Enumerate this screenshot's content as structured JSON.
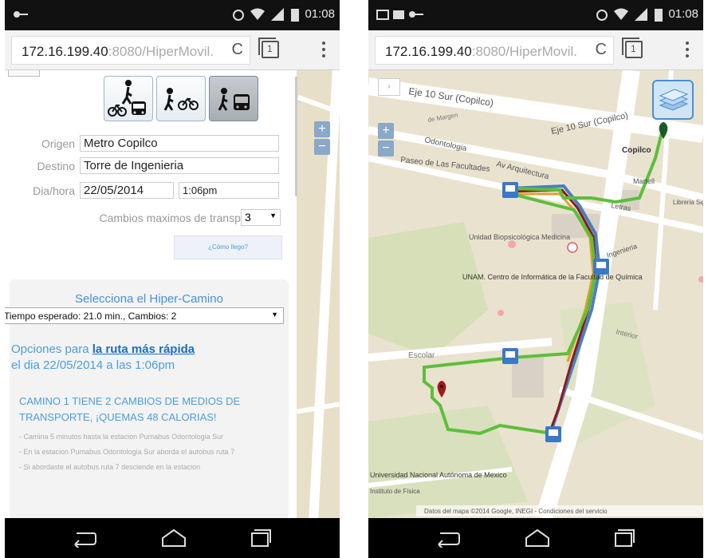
{
  "status": {
    "time": "01:08"
  },
  "left": {
    "url": {
      "host": "172.16.199.40",
      "path": ":8080/HiperMovil."
    },
    "form": {
      "origin_label": "Origen",
      "origin_value": "Metro Copilco",
      "dest_label": "Destino",
      "dest_value": "Torre de Ingenieria",
      "date_label": "Dia/hora",
      "date_value": "22/05/2014",
      "time_value": "1:06pm",
      "changes_label": "Cambios maximos de transporte",
      "changes_value": "3",
      "submit": "¿Cómo llego?"
    },
    "panel": {
      "title": "Selecciona el Hiper-Camino",
      "select_value": "Tiempo esperado: 21.0 min., Cambios: 2",
      "options_prefix": "Opciones para ",
      "options_link": "la ruta más rápida",
      "options_date": "el dia 22/05/2014 a las 1:06pm",
      "camino_title": "CAMINO 1 TIENE 2 CAMBIOS DE MEDIOS DE TRANSPORTE, ¡QUEMAS 48 CALORIAS!",
      "steps": [
        "- Camina 5 minutos hasta la estacion Pumabus Odontologia Sur",
        "- En la estacion Pumabus Odontologia Sur aborda el autobus ruta 7",
        "- Si abordaste el autobus ruta 7 desciende en la estacion"
      ]
    }
  },
  "right": {
    "url": {
      "host": "172.16.199.40",
      "path": ":8080/HiperMovil."
    },
    "map_labels": {
      "eje10": "Eje 10 Sur (Copilco)",
      "eje10b": "Eje 10 Sur (Copilco)",
      "magisterio": "de Margen",
      "odontologia": "Odontologia",
      "paseo": "Paseo de Las Facultades",
      "arquitectura": "Av Arquitectura",
      "copilco": "Copilco",
      "martell": "Martell",
      "libreria": "Libreria Siglo XX",
      "letras": "Letras",
      "unidad": "Unidad Biopsicológica Medicina",
      "unam": "UNAM. Centro de Informática de la Facultad de Química",
      "escolar": "Escolar",
      "ingenieria": "Ingenieria",
      "interior": "Interior",
      "universidad": "Universidad Nacional Autónoma de Mexico",
      "instituto": "Instituto de Física",
      "attribution": "Datos del mapa ©2014 Google, INEGI - Condiciones del servicio"
    }
  },
  "icons": [
    "back-icon",
    "home-icon",
    "recents-icon",
    "walk-bike-bus-icon",
    "walk-bike-icon",
    "walk-bus-icon",
    "reload-icon",
    "tabs-icon",
    "menu-icon",
    "layers-icon",
    "bus-stop-icon",
    "map-marker-icon",
    "zoom-in-icon",
    "zoom-out-icon"
  ],
  "colors": {
    "route_green": "#5cbf3a",
    "route_red": "#8b1a1a",
    "route_blue": "#4a7fc0",
    "link_blue": "#4a9ee0",
    "map_bg": "#e9e2cf"
  }
}
